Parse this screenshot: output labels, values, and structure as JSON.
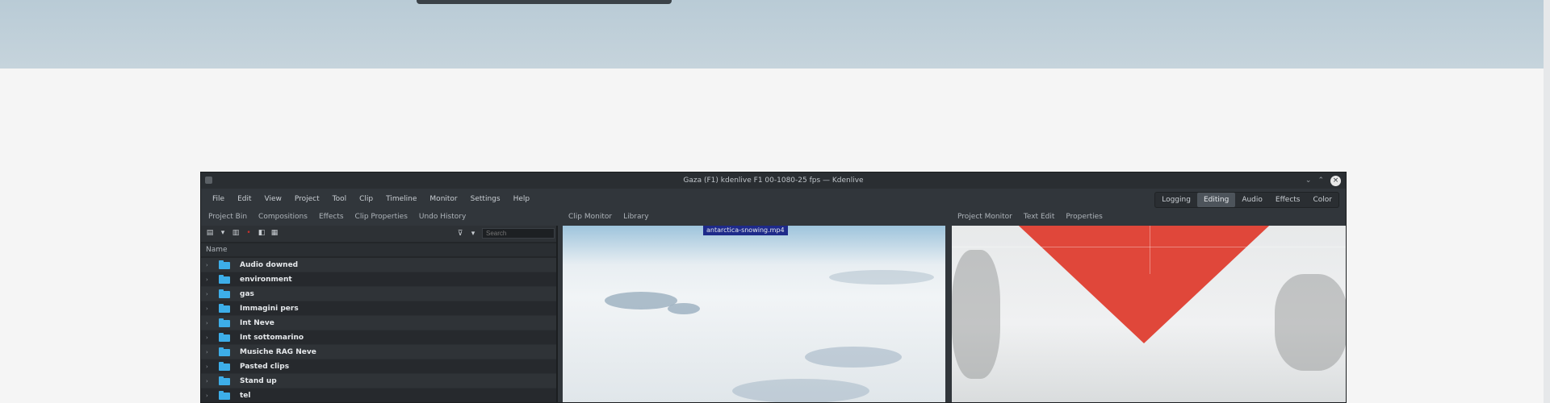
{
  "app": {
    "title": "Gaza (F1) kdenlive F1 00-1080-25 fps — Kdenlive",
    "window_controls": {
      "minimize": "⌄",
      "maximize": "⌃",
      "close": "×"
    }
  },
  "menu": [
    "File",
    "Edit",
    "View",
    "Project",
    "Tool",
    "Clip",
    "Timeline",
    "Monitor",
    "Settings",
    "Help"
  ],
  "layouts": {
    "items": [
      "Logging",
      "Editing",
      "Audio",
      "Effects",
      "Color"
    ],
    "active": "Editing"
  },
  "bin_tabs": [
    "Project Bin",
    "Compositions",
    "Effects",
    "Clip Properties",
    "Undo History"
  ],
  "monitor_tabs": [
    "Clip Monitor",
    "Library"
  ],
  "project_monitor_tabs": [
    "Project Monitor",
    "Text Edit",
    "Properties"
  ],
  "bin": {
    "search_placeholder": "Search",
    "name_header": "Name",
    "folders": [
      "Audio downed",
      "environment",
      "gas",
      "Immagini pers",
      "Int Neve",
      "Int sottomarino",
      "Musiche RAG Neve",
      "Pasted clips",
      "Stand up",
      "tel"
    ]
  },
  "clip_monitor": {
    "clip_name": "antarctica-snowing.mp4"
  },
  "icons": {
    "bin_toolbar": [
      "add-clip-icon",
      "dropdown-icon",
      "delete-icon",
      "red-dot-icon",
      "folder-new-icon",
      "properties-icon"
    ],
    "filter": "filter-icon"
  }
}
